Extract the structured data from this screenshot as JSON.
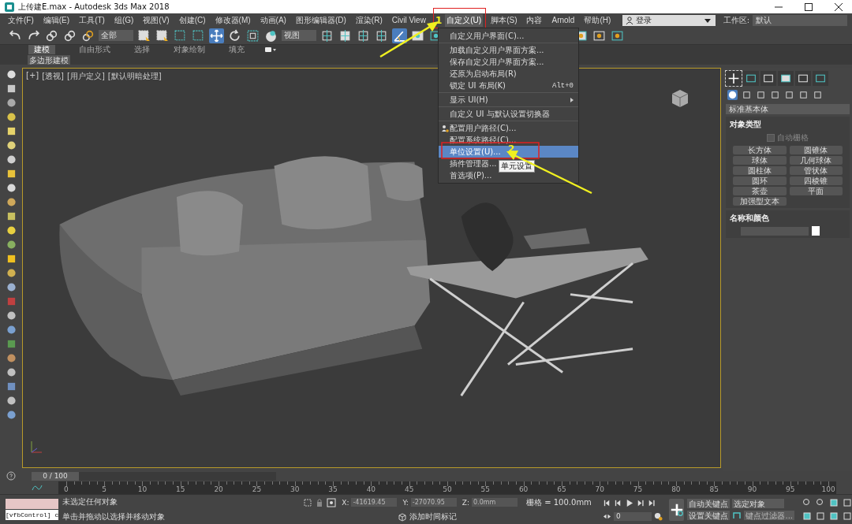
{
  "window": {
    "title": "上传建E.max - Autodesk 3ds Max 2018"
  },
  "menu_bar": [
    {
      "label": "文件(F)",
      "selected": false
    },
    {
      "label": "编辑(E)",
      "selected": false
    },
    {
      "label": "工具(T)",
      "selected": false
    },
    {
      "label": "组(G)",
      "selected": false
    },
    {
      "label": "视图(V)",
      "selected": false
    },
    {
      "label": "创建(C)",
      "selected": false
    },
    {
      "label": "修改器(M)",
      "selected": false
    },
    {
      "label": "动画(A)",
      "selected": false
    },
    {
      "label": "图形编辑器(D)",
      "selected": false
    },
    {
      "label": "渲染(R)",
      "selected": false
    },
    {
      "label": "Civil View",
      "selected": false
    },
    {
      "label": "自定义(U)",
      "selected": true
    },
    {
      "label": "脚本(S)",
      "selected": false
    },
    {
      "label": "内容",
      "selected": false
    },
    {
      "label": "Arnold",
      "selected": false
    },
    {
      "label": "帮助(H)",
      "selected": false
    }
  ],
  "account": {
    "label": "登录"
  },
  "workspace": {
    "label": "工作区:",
    "value": "默认"
  },
  "toolbar": {
    "selection_filter": "全部",
    "reference_coord": "视图",
    "move_tool_on": true,
    "angle_snap_on": true
  },
  "ribbon": {
    "tabs": [
      {
        "label": "建模",
        "selected": true
      },
      {
        "label": "自由形式",
        "selected": false
      },
      {
        "label": "选择",
        "selected": false
      },
      {
        "label": "对象绘制",
        "selected": false
      },
      {
        "label": "填充",
        "selected": false
      }
    ],
    "panel": "多边形建模"
  },
  "viewport": {
    "labels": [
      "[+]",
      "[透视]",
      "[用户定义]",
      "[默认明暗处理]"
    ]
  },
  "customize_menu": {
    "items": [
      {
        "kind": "item",
        "label": "自定义用户界面(C)...",
        "selected": false
      },
      {
        "kind": "separator"
      },
      {
        "kind": "item",
        "label": "加载自定义用户界面方案...",
        "selected": false
      },
      {
        "kind": "item",
        "label": "保存自定义用户界面方案...",
        "selected": false
      },
      {
        "kind": "item",
        "label": "还原为启动布局(R)",
        "selected": false
      },
      {
        "kind": "item",
        "label": "锁定 UI 布局(K)",
        "shortcut": "Alt+0",
        "selected": false
      },
      {
        "kind": "separator"
      },
      {
        "kind": "submenu",
        "label": "显示 UI(H)",
        "selected": false
      },
      {
        "kind": "separator"
      },
      {
        "kind": "item",
        "label": "自定义 UI 与默认设置切换器",
        "selected": false
      },
      {
        "kind": "separator"
      },
      {
        "kind": "icon-item",
        "label": "配置用户路径(C)...",
        "selected": false
      },
      {
        "kind": "item",
        "label": "配置系统路径(C)...",
        "selected": false
      },
      {
        "kind": "item",
        "label": "单位设置(U)...",
        "selected": true
      },
      {
        "kind": "item",
        "label": "插件管理器...",
        "selected": false
      },
      {
        "kind": "item",
        "label": "首选项(P)...",
        "selected": false
      }
    ],
    "tooltip": "单元设置"
  },
  "annotations": [
    {
      "label": "1"
    },
    {
      "label": "2"
    }
  ],
  "command_panel": {
    "tabs": [
      {
        "selected": true
      },
      {
        "selected": false
      },
      {
        "selected": false
      },
      {
        "selected": false
      },
      {
        "selected": false
      },
      {
        "selected": false
      }
    ],
    "categories": [
      {
        "selected": true
      },
      {
        "selected": false
      },
      {
        "selected": false
      },
      {
        "selected": false
      },
      {
        "selected": false
      },
      {
        "selected": false
      },
      {
        "selected": false
      }
    ],
    "primitive_type": "标准基本体",
    "object_type": {
      "title": "对象类型",
      "autogrid": {
        "label": "自动栅格",
        "checked": false
      },
      "buttons": [
        "长方体",
        "圆锥体",
        "球体",
        "几何球体",
        "圆柱体",
        "管状体",
        "圆环",
        "四棱锥",
        "茶壶",
        "平面",
        "加强型文本"
      ]
    },
    "name_color": {
      "title": "名称和颜色"
    }
  },
  "time_slider": {
    "counter": "0 / 100",
    "level": 0
  },
  "track_bar": {
    "ticks": [
      "0",
      "5",
      "10",
      "15",
      "20",
      "25",
      "30",
      "35",
      "40",
      "45",
      "50",
      "55",
      "60",
      "65",
      "70",
      "75",
      "80",
      "85",
      "90",
      "95",
      "100"
    ]
  },
  "status": {
    "maxscript": "[vfbControl] c",
    "messages": [
      "未选定任何对象",
      "单击并拖动以选择并移动对象"
    ],
    "coords": [
      {
        "axis": "X:",
        "value": "-41619.45"
      },
      {
        "axis": "Y:",
        "value": "-27070.95"
      },
      {
        "axis": "Z:",
        "value": "0.0mm"
      }
    ],
    "grid": "栅格 = 100.0mm",
    "time_tag": "添加时间标记",
    "current_frame": "0",
    "auto_key": "自动关键点",
    "set_key": "设置关键点",
    "key_set": "选定对象",
    "key_filters": "键点过滤器..."
  }
}
